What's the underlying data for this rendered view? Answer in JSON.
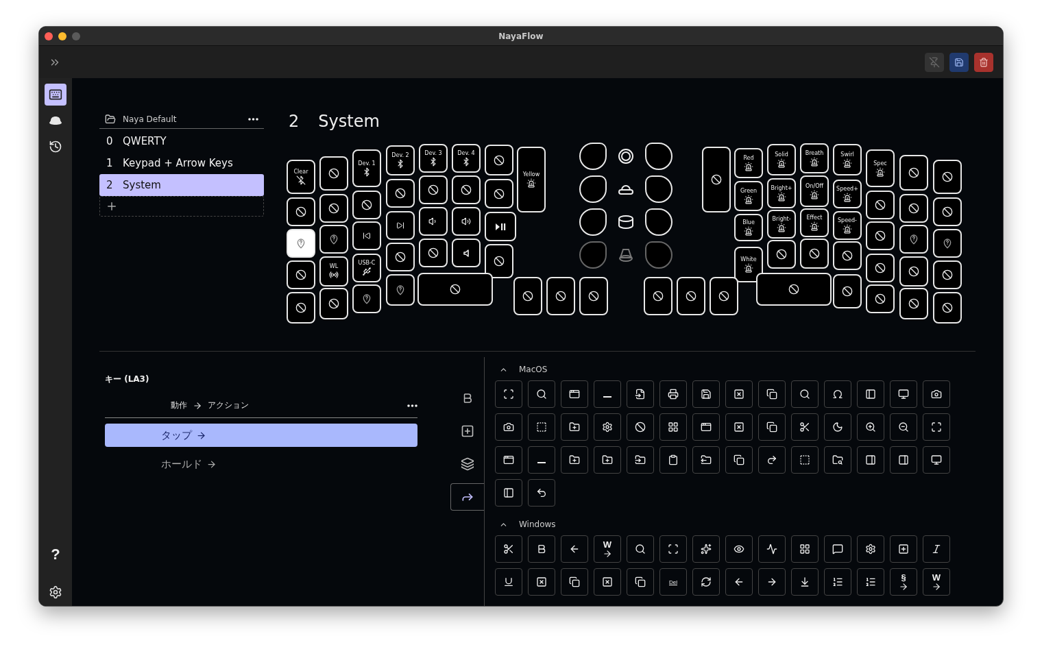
{
  "window": {
    "title": "NayaFlow",
    "traffic_lights": [
      {
        "kind": "close",
        "disabled": false
      },
      {
        "kind": "minimize",
        "disabled": false
      },
      {
        "kind": "zoom",
        "disabled": true
      }
    ]
  },
  "toolbar": {
    "buttons": [
      {
        "kind": "pin",
        "disabled": true
      },
      {
        "kind": "save",
        "disabled": false
      },
      {
        "kind": "delete",
        "disabled": false
      }
    ]
  },
  "rail": {
    "items": [
      {
        "kind": "keyboard",
        "selected": true
      },
      {
        "kind": "base",
        "selected": false
      },
      {
        "kind": "history",
        "selected": false
      }
    ],
    "help": "?"
  },
  "layers": {
    "profile": "Naya Default",
    "items": [
      {
        "number": "0",
        "name": "QWERTY",
        "selected": false
      },
      {
        "number": "1",
        "name": "Keypad + Arrow Keys",
        "selected": false
      },
      {
        "number": "2",
        "name": "System",
        "selected": true
      }
    ]
  },
  "layer_title": {
    "number": "2",
    "name": "System"
  },
  "keyboard": {
    "left": [
      {
        "kind": "bluetooth-off",
        "label": "Clear",
        "selected": false
      },
      {
        "kind": "blocked",
        "selected": false
      },
      {
        "kind": "unknown",
        "selected": true
      },
      {
        "kind": "blocked",
        "selected": false
      },
      {
        "kind": "blocked",
        "selected": false
      },
      {
        "kind": "blocked",
        "selected": false
      },
      {
        "kind": "blocked",
        "selected": false
      },
      {
        "kind": "unknown",
        "selected": false
      },
      {
        "kind": "wireless",
        "label": "WL",
        "selected": false
      },
      {
        "kind": "blocked",
        "selected": false
      },
      {
        "kind": "bluetooth",
        "label": "Dev. 1",
        "selected": false
      },
      {
        "kind": "blocked",
        "selected": false
      },
      {
        "kind": "prev",
        "selected": false
      },
      {
        "kind": "usb",
        "label": "USB-C",
        "selected": false
      },
      {
        "kind": "unknown",
        "selected": false
      },
      {
        "kind": "bluetooth",
        "label": "Dev. 2",
        "selected": false
      },
      {
        "kind": "blocked",
        "selected": false
      },
      {
        "kind": "next",
        "selected": false
      },
      {
        "kind": "blocked",
        "selected": false
      },
      {
        "kind": "unknown",
        "selected": false
      },
      {
        "kind": "bluetooth",
        "label": "Dev. 3",
        "selected": false
      },
      {
        "kind": "blocked",
        "selected": false
      },
      {
        "kind": "vol-down",
        "selected": false
      },
      {
        "kind": "blocked",
        "selected": false
      },
      {
        "kind": "bluetooth",
        "label": "Dev. 4",
        "selected": false
      },
      {
        "kind": "blocked",
        "selected": false
      },
      {
        "kind": "vol-up",
        "selected": false
      },
      {
        "kind": "mute",
        "selected": false
      },
      {
        "kind": "blocked",
        "selected": false
      },
      {
        "kind": "blocked",
        "selected": false
      },
      {
        "kind": "play-pause",
        "selected": false
      },
      {
        "kind": "blocked",
        "selected": false
      },
      {
        "kind": "light",
        "label": "Yellow",
        "selected": false
      }
    ],
    "left_thumb": [
      {
        "kind": "blocked",
        "selected": false
      },
      {
        "kind": "blocked",
        "selected": false
      },
      {
        "kind": "blocked",
        "selected": false
      },
      {
        "kind": "blocked",
        "selected": false
      }
    ],
    "encoders": [
      {
        "kind": "ring",
        "disabled": false
      },
      {
        "kind": "dome",
        "disabled": false
      },
      {
        "kind": "cylinder",
        "disabled": false
      },
      {
        "kind": "cone",
        "disabled": true
      }
    ],
    "right": [
      {
        "kind": "blocked",
        "selected": false
      },
      {
        "kind": "light",
        "label": "Red",
        "selected": false
      },
      {
        "kind": "light",
        "label": "Green",
        "selected": false
      },
      {
        "kind": "light",
        "label": "Blue",
        "selected": false
      },
      {
        "kind": "light",
        "label": "White",
        "selected": false
      },
      {
        "kind": "light",
        "label": "Solid",
        "selected": false
      },
      {
        "kind": "light",
        "label": "Bright+",
        "selected": false
      },
      {
        "kind": "light",
        "label": "Bright-",
        "selected": false
      },
      {
        "kind": "blocked",
        "selected": false
      },
      {
        "kind": "light",
        "label": "Breath",
        "selected": false
      },
      {
        "kind": "light",
        "label": "On/Off",
        "selected": false
      },
      {
        "kind": "light",
        "label": "Effect",
        "selected": false
      },
      {
        "kind": "blocked",
        "selected": false
      },
      {
        "kind": "light",
        "label": "Swirl",
        "selected": false
      },
      {
        "kind": "light",
        "label": "Speed+",
        "selected": false
      },
      {
        "kind": "light",
        "label": "Speed-",
        "selected": false
      },
      {
        "kind": "blocked",
        "selected": false
      },
      {
        "kind": "blocked",
        "selected": false
      },
      {
        "kind": "light",
        "label": "Spec",
        "selected": false
      },
      {
        "kind": "blocked",
        "selected": false
      },
      {
        "kind": "blocked",
        "selected": false
      },
      {
        "kind": "blocked",
        "selected": false
      },
      {
        "kind": "blocked",
        "selected": false
      },
      {
        "kind": "blocked",
        "selected": false
      },
      {
        "kind": "blocked",
        "selected": false
      },
      {
        "kind": "unknown",
        "selected": false
      },
      {
        "kind": "blocked",
        "selected": false
      },
      {
        "kind": "blocked",
        "selected": false
      },
      {
        "kind": "blocked",
        "selected": false
      },
      {
        "kind": "blocked",
        "selected": false
      },
      {
        "kind": "unknown",
        "selected": false
      },
      {
        "kind": "blocked",
        "selected": false
      },
      {
        "kind": "blocked",
        "selected": false
      }
    ],
    "right_thumb": [
      {
        "kind": "blocked",
        "selected": false
      },
      {
        "kind": "blocked",
        "selected": false
      },
      {
        "kind": "blocked",
        "selected": false
      },
      {
        "kind": "blocked",
        "selected": false
      }
    ]
  },
  "key_editor": {
    "title": "キー (LA3)",
    "header_from": "動作",
    "header_to": "アクション",
    "rows": [
      {
        "label": "タップ",
        "selected": true
      },
      {
        "label": "ホールド",
        "selected": false
      }
    ]
  },
  "category_tabs": [
    {
      "kind": "bold",
      "selected": false
    },
    {
      "kind": "add",
      "selected": false
    },
    {
      "kind": "layers",
      "selected": false
    },
    {
      "kind": "forward",
      "selected": true
    }
  ],
  "sections": [
    {
      "title": "MacOS",
      "expanded": true,
      "actions": [
        {
          "kind": "scan"
        },
        {
          "kind": "search"
        },
        {
          "kind": "app-window"
        },
        {
          "kind": "minus"
        },
        {
          "kind": "file-input"
        },
        {
          "kind": "printer"
        },
        {
          "kind": "save"
        },
        {
          "kind": "square-x"
        },
        {
          "kind": "copy"
        },
        {
          "kind": "search"
        },
        {
          "kind": "omega"
        },
        {
          "kind": "panel-left"
        },
        {
          "kind": "monitor"
        },
        {
          "kind": "camera"
        },
        {
          "kind": "camera"
        },
        {
          "kind": "square-dashed"
        },
        {
          "kind": "folder-plus"
        },
        {
          "kind": "settings"
        },
        {
          "kind": "ban"
        },
        {
          "kind": "layout-grid"
        },
        {
          "kind": "app-window"
        },
        {
          "kind": "square-x"
        },
        {
          "kind": "copy"
        },
        {
          "kind": "scissors"
        },
        {
          "kind": "moon"
        },
        {
          "kind": "zoom-in"
        },
        {
          "kind": "zoom-out"
        },
        {
          "kind": "maximize"
        },
        {
          "kind": "app-window"
        },
        {
          "kind": "minus"
        },
        {
          "kind": "folder-plus"
        },
        {
          "kind": "folder-plus"
        },
        {
          "kind": "folder-input"
        },
        {
          "kind": "clipboard"
        },
        {
          "kind": "folder-output"
        },
        {
          "kind": "copy"
        },
        {
          "kind": "redo"
        },
        {
          "kind": "square-dashed"
        },
        {
          "kind": "folder-search"
        },
        {
          "kind": "panel-right"
        },
        {
          "kind": "panel-right"
        },
        {
          "kind": "monitor"
        },
        {
          "kind": "panel-left"
        },
        {
          "kind": "undo"
        }
      ]
    },
    {
      "title": "Windows",
      "expanded": true,
      "actions": [
        {
          "kind": "scissors"
        },
        {
          "kind": "bold"
        },
        {
          "kind": "arrow-left"
        },
        {
          "kind": "text-arrow",
          "label": "W"
        },
        {
          "kind": "search"
        },
        {
          "kind": "scan"
        },
        {
          "kind": "sparkles"
        },
        {
          "kind": "eye"
        },
        {
          "kind": "activity"
        },
        {
          "kind": "layout-grid"
        },
        {
          "kind": "message-square"
        },
        {
          "kind": "settings"
        },
        {
          "kind": "square-plus"
        },
        {
          "kind": "italic"
        },
        {
          "kind": "underline"
        },
        {
          "kind": "square-x"
        },
        {
          "kind": "copy"
        },
        {
          "kind": "square-x"
        },
        {
          "kind": "copy"
        },
        {
          "kind": "text",
          "label": "Del"
        },
        {
          "kind": "refresh"
        },
        {
          "kind": "arrow-left"
        },
        {
          "kind": "arrow-right"
        },
        {
          "kind": "arrow-down-to-line"
        },
        {
          "kind": "list-ordered"
        },
        {
          "kind": "list-ordered"
        },
        {
          "kind": "text-arrow",
          "label": "§"
        },
        {
          "kind": "text-arrow",
          "label": "W"
        }
      ]
    }
  ]
}
